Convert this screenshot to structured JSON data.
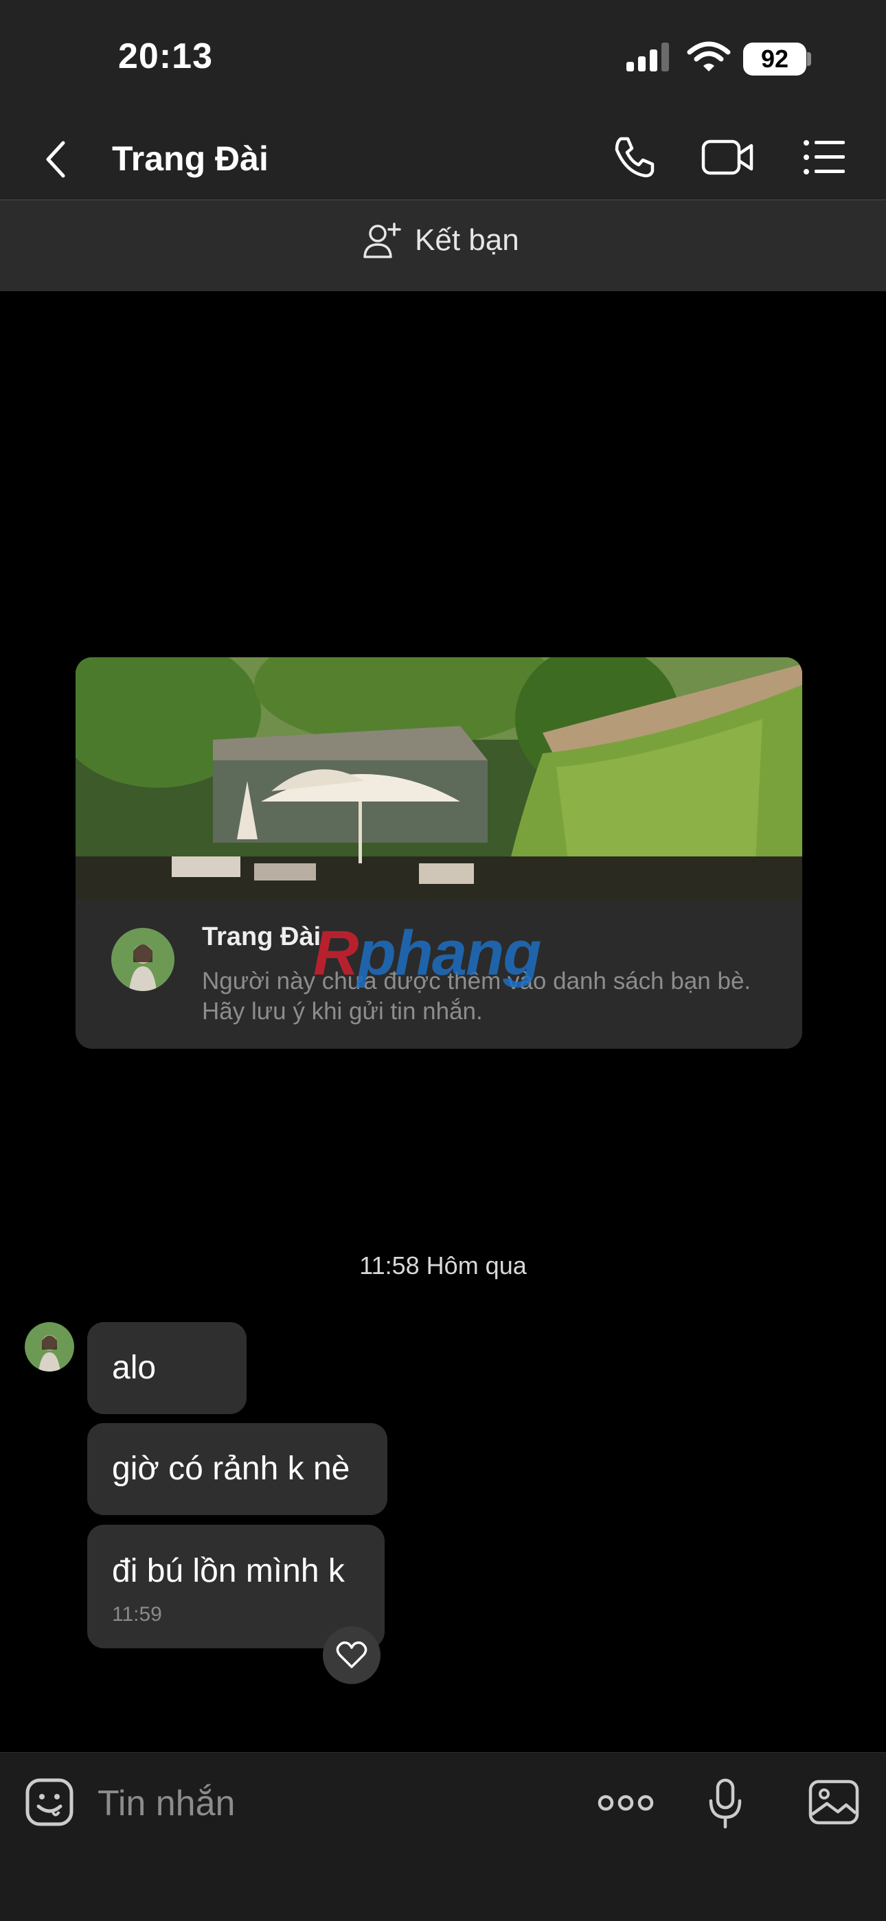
{
  "status": {
    "time": "20:13",
    "battery": "92"
  },
  "header": {
    "title": "Trang Đài"
  },
  "friend_bar": {
    "label": "Kết bạn"
  },
  "profile_card": {
    "name": "Trang Đài",
    "note": "Người này chưa được thêm vào danh sách bạn bè. Hãy lưu ý khi gửi tin nhắn."
  },
  "watermark": {
    "part1": "R",
    "part2": "phang"
  },
  "conversation": {
    "timestamp": "11:58 Hôm qua",
    "messages": [
      {
        "text": "alo"
      },
      {
        "text": "giờ có rảnh k nè"
      },
      {
        "text": "đi bú lồn mình k",
        "time": "11:59"
      }
    ]
  },
  "composer": {
    "placeholder": "Tin nhắn"
  },
  "colors": {
    "background": "#000000",
    "bar": "#232323",
    "bubble": "#2f2f2f",
    "watermark_blue": "#1d6fc2",
    "watermark_red": "#d0202f"
  }
}
